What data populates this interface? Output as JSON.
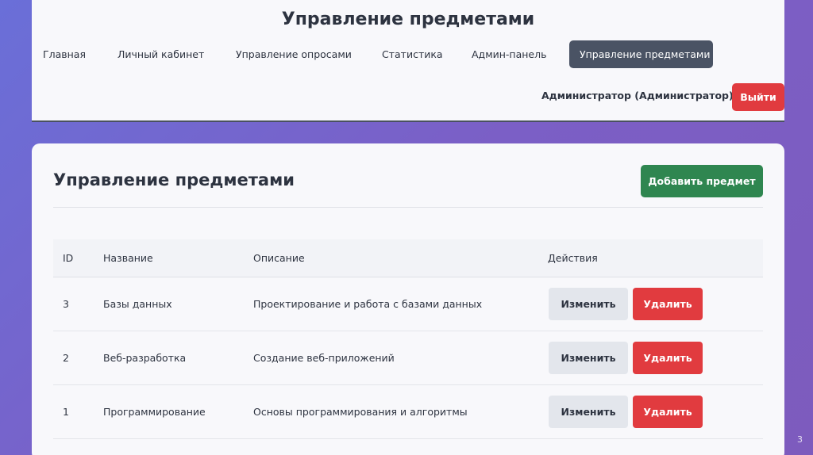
{
  "header": {
    "title": "Управление предметами",
    "nav": [
      {
        "label": "Главная",
        "active": false
      },
      {
        "label": "Личный кабинет",
        "active": false
      },
      {
        "label": "Управление опросами",
        "active": false
      },
      {
        "label": "Статистика",
        "active": false
      },
      {
        "label": "Админ-панель",
        "active": false
      },
      {
        "label": "Управление предметами",
        "active": true
      }
    ],
    "user": "Администратор (Администратор)",
    "logout_label": "Выйти"
  },
  "main": {
    "title": "Управление предметами",
    "add_label": "Добавить предмет",
    "columns": {
      "id": "ID",
      "name": "Название",
      "description": "Описание",
      "actions": "Действия"
    },
    "rows": [
      {
        "id": "3",
        "name": "Базы данных",
        "description": "Проектирование и работа с базами данных",
        "edit": "Изменить",
        "delete": "Удалить"
      },
      {
        "id": "2",
        "name": "Веб-разработка",
        "description": "Создание веб-приложений",
        "edit": "Изменить",
        "delete": "Удалить"
      },
      {
        "id": "1",
        "name": "Программирование",
        "description": "Основы программирования и алгоритмы",
        "edit": "Изменить",
        "delete": "Удалить"
      }
    ]
  },
  "slide_number": "3",
  "colors": {
    "active_nav": "#4a5364",
    "danger": "#e13b3f",
    "success": "#2f8650",
    "secondary": "#e3e6ec"
  }
}
